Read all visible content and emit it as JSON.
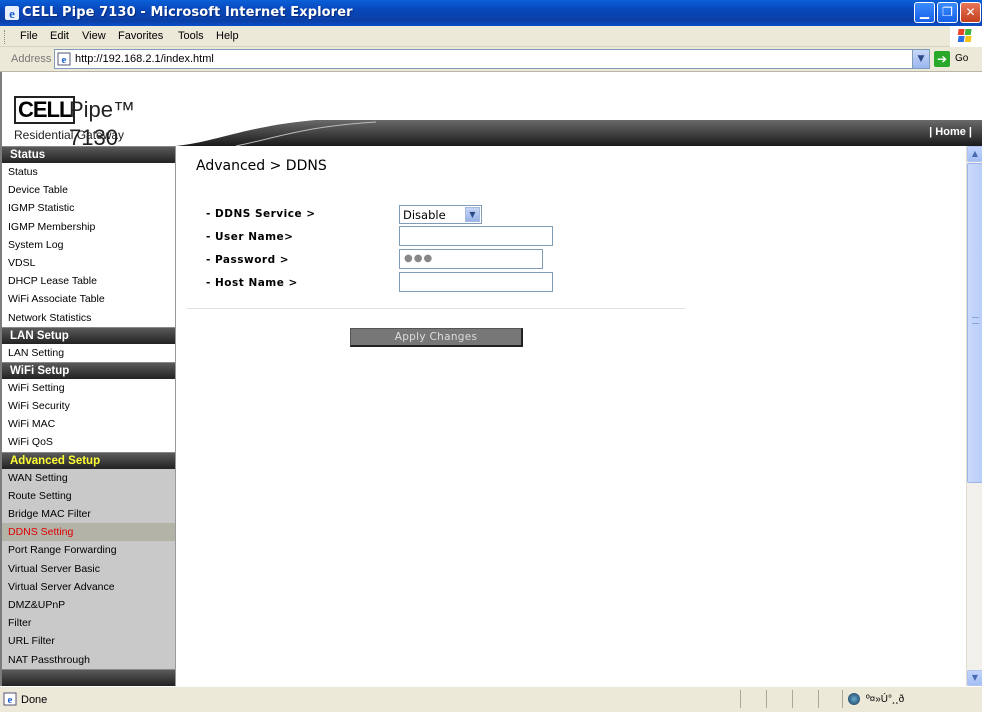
{
  "window": {
    "title": "CELL Pipe 7130 - Microsoft Internet Explorer"
  },
  "menu": [
    "File",
    "Edit",
    "View",
    "Favorites",
    "Tools",
    "Help"
  ],
  "address": {
    "label": "Address",
    "url": "http://192.168.2.1/index.html",
    "go_label": "Go"
  },
  "brand": {
    "cell": "CELL",
    "pipe": "Pipe™ 7130",
    "subtitle": "Residential Gateway",
    "home_link": "| Home |"
  },
  "sidebar": {
    "sections": [
      {
        "heading": "Status",
        "items": [
          "Status",
          "Device Table",
          "IGMP Statistic",
          "IGMP Membership",
          "System Log",
          "VDSL",
          "DHCP Lease Table",
          "WiFi Associate Table",
          "Network Statistics"
        ]
      },
      {
        "heading": "LAN Setup",
        "items": [
          "LAN Setting"
        ]
      },
      {
        "heading": "WiFi Setup",
        "items": [
          "WiFi Setting",
          "WiFi Security",
          "WiFi MAC",
          "WiFi QoS"
        ]
      },
      {
        "heading": "Advanced Setup",
        "items": [
          "WAN Setting",
          "Route Setting",
          "Bridge MAC Filter",
          "DDNS Setting",
          "Port Range Forwarding",
          "Virtual Server Basic",
          "Virtual Server Advance",
          "DMZ&UPnP",
          "Filter",
          "URL Filter",
          "NAT Passthrough"
        ]
      }
    ],
    "active_item": "DDNS Setting"
  },
  "main": {
    "title": "Advanced > DDNS",
    "fields": {
      "service_label": "- DDNS Service >",
      "service_value": "Disable",
      "username_label": "- User Name>",
      "username_value": "",
      "password_label": "- Password >",
      "password_value": "●●●",
      "host_label": "- Host Name >",
      "host_value": ""
    },
    "apply_label": "Apply Changes"
  },
  "status": {
    "text": "Done",
    "zone": "º¤»Ú°¸¸ð"
  }
}
